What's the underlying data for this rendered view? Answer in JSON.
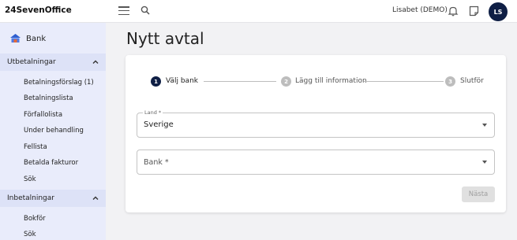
{
  "app": {
    "logo_mark": "24",
    "logo_text": "24SevenOffice"
  },
  "header": {
    "user_name": "Lisabet (DEMO)",
    "avatar_initials": "LS"
  },
  "sidebar": {
    "bank_label": "Bank",
    "sections": [
      {
        "title": "Utbetalningar",
        "items": [
          "Betalningsförslag (1)",
          "Betalningslista",
          "Förfallolista",
          "Under behandling",
          "Fellista",
          "Betalda fakturor",
          "Sök"
        ]
      },
      {
        "title": "Inbetalningar",
        "items": [
          "Bokför",
          "Sök"
        ]
      }
    ]
  },
  "main": {
    "title": "Nytt avtal",
    "steps": [
      {
        "number": "1",
        "label": "Välj bank",
        "active": true
      },
      {
        "number": "2",
        "label": "Lägg till information",
        "active": false
      },
      {
        "number": "3",
        "label": "Slutför",
        "active": false
      }
    ],
    "country_field": {
      "legend": "Land *",
      "value": "Sverige"
    },
    "bank_field": {
      "placeholder": "Bank *"
    },
    "next_label": "Nästa"
  },
  "colors": {
    "accent": "#0f1f45",
    "sidebar_bg": "#e9ecfb",
    "step_inactive": "#bdbdbd"
  }
}
